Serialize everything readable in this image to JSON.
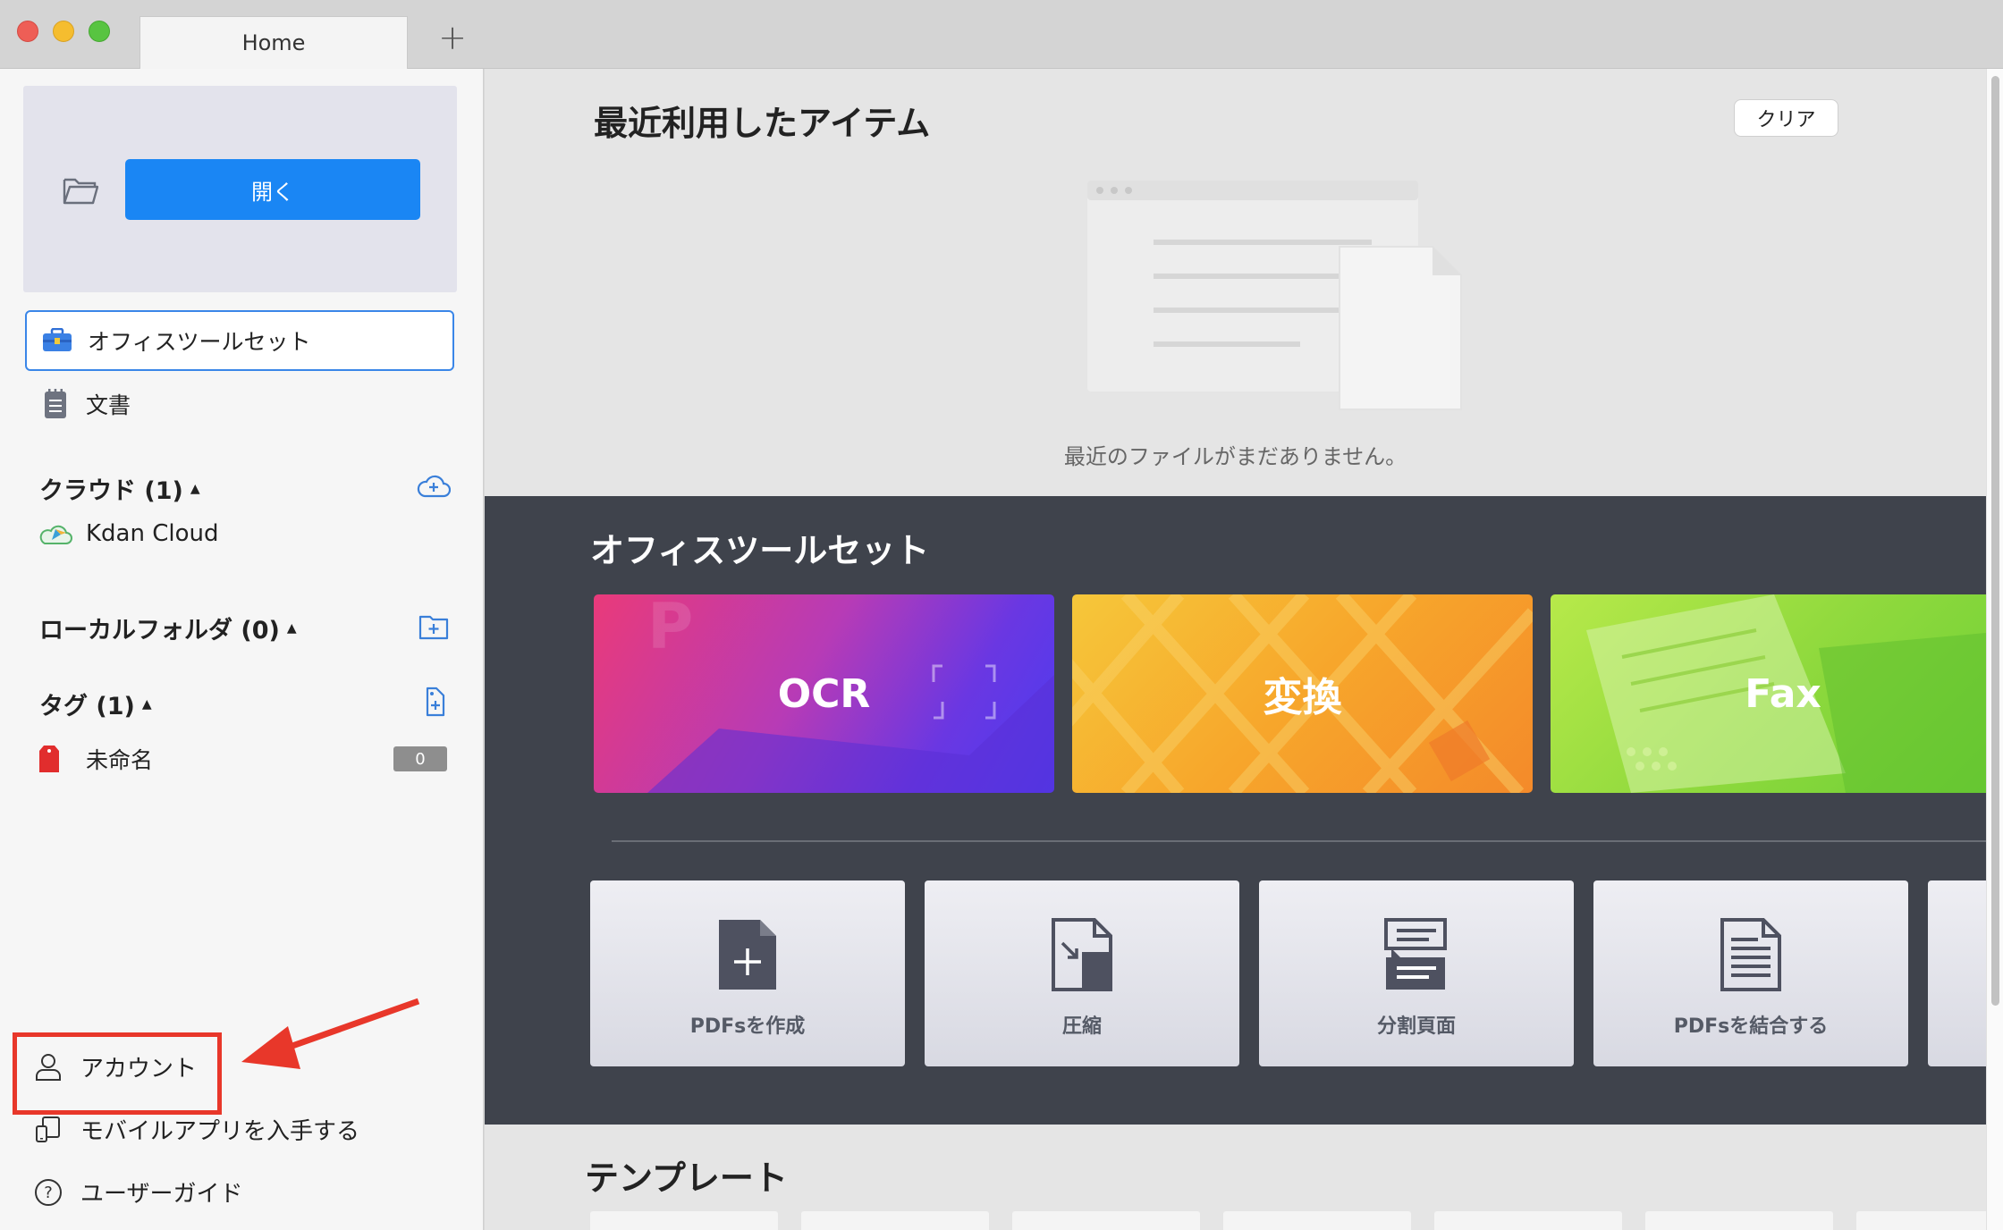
{
  "window": {
    "tab_label": "Home",
    "new_tab_label": "+"
  },
  "sidebar": {
    "open_button": "開く",
    "nav": [
      {
        "label": "オフィスツールセット",
        "icon": "toolbox-icon",
        "selected": true
      },
      {
        "label": "文書",
        "icon": "document-icon",
        "selected": false
      }
    ],
    "cloud": {
      "heading": "クラウド (1)",
      "item": "Kdan Cloud"
    },
    "local": {
      "heading": "ローカルフォルダ (0)"
    },
    "tags": {
      "heading": "タグ (1)",
      "item": "未命名",
      "count": "0"
    },
    "bottom": [
      {
        "label": "アカウント",
        "icon": "user-icon"
      },
      {
        "label": "モバイルアプリを入手する",
        "icon": "mobile-app-icon"
      },
      {
        "label": "ユーザーガイド",
        "icon": "help-icon"
      }
    ]
  },
  "main": {
    "recent_title": "最近利用したアイテム",
    "clear_button": "クリア",
    "empty_text": "最近のファイルがまだありません。",
    "toolset_title": "オフィスツールセット",
    "big_tools": [
      "OCR",
      "変換",
      "Fax"
    ],
    "small_tools": [
      "PDFsを作成",
      "圧縮",
      "分割頁面",
      "PDFsを結合する"
    ],
    "template_title": "テンプレート"
  },
  "colors": {
    "accent": "#1a86f4",
    "highlight": "#e8372a",
    "band": "#3f434c"
  }
}
